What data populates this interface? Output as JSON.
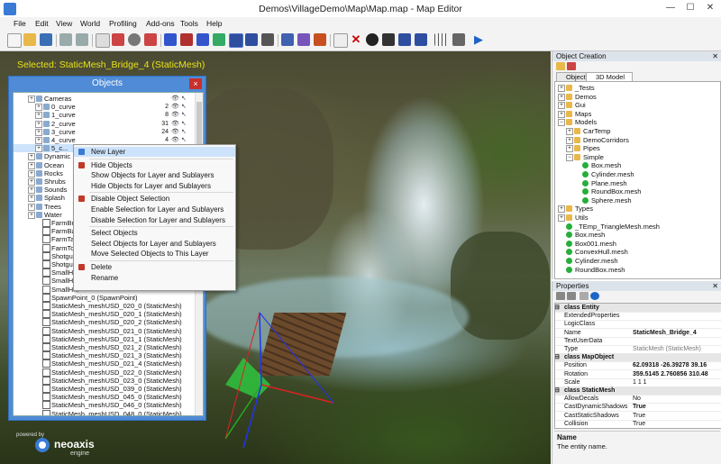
{
  "window": {
    "title": "Demos\\VillageDemo\\Map\\Map.map - Map Editor",
    "min": "—",
    "max": "☐",
    "close": "✕"
  },
  "menu": [
    "File",
    "Edit",
    "View",
    "World",
    "Profiling",
    "Add-ons",
    "Tools",
    "Help"
  ],
  "viewport": {
    "selected_label": "Selected: StaticMesh_Bridge_4 (StaticMesh)",
    "logo": {
      "powered_by": "powered by",
      "name": "neoaxis",
      "sub": "engine"
    }
  },
  "objects_window": {
    "title": "Objects",
    "close": "×",
    "rows": [
      {
        "label": "Cameras",
        "num": "",
        "type": "folder"
      },
      {
        "label": "0_curve",
        "num": "2",
        "type": "item"
      },
      {
        "label": "1_curve",
        "num": "8",
        "type": "item"
      },
      {
        "label": "2_curve",
        "num": "31",
        "type": "item"
      },
      {
        "label": "3_curve",
        "num": "24",
        "type": "item"
      },
      {
        "label": "4_curve",
        "num": "4",
        "type": "item"
      },
      {
        "label": "5_c...",
        "num": "",
        "type": "item"
      },
      {
        "label": "Dynamic",
        "num": "",
        "type": "folder"
      },
      {
        "label": "Ocean",
        "num": "",
        "type": "folder"
      },
      {
        "label": "Rocks",
        "num": "",
        "type": "folder"
      },
      {
        "label": "Shrubs",
        "num": "",
        "type": "folder"
      },
      {
        "label": "Sounds",
        "num": "",
        "type": "folder"
      },
      {
        "label": "Splash",
        "num": "",
        "type": "folder"
      },
      {
        "label": "Trees",
        "num": "",
        "type": "folder"
      },
      {
        "label": "Water",
        "num": "",
        "type": "folder"
      },
      {
        "label": "FarmBu...",
        "num": "",
        "type": "check"
      },
      {
        "label": "FarmBa...",
        "num": "",
        "type": "check"
      },
      {
        "label": "FarmTa...",
        "num": "",
        "type": "check"
      },
      {
        "label": "FarmTo...",
        "num": "",
        "type": "check"
      },
      {
        "label": "Shotgu...",
        "num": "",
        "type": "check"
      },
      {
        "label": "Shotgu...",
        "num": "",
        "type": "check"
      },
      {
        "label": "SmallH...",
        "num": "",
        "type": "check"
      },
      {
        "label": "SmallH...",
        "num": "",
        "type": "check"
      },
      {
        "label": "SmallH...",
        "num": "",
        "type": "check"
      },
      {
        "label": "SpawnPoint_0 (SpawnPoint)",
        "num": "",
        "type": "check"
      },
      {
        "label": "StaticMesh_meshUSD_020_0 (StaticMesh)",
        "num": "",
        "type": "check"
      },
      {
        "label": "StaticMesh_meshUSD_020_1 (StaticMesh)",
        "num": "",
        "type": "check"
      },
      {
        "label": "StaticMesh_meshUSD_020_2 (StaticMesh)",
        "num": "",
        "type": "check"
      },
      {
        "label": "StaticMesh_meshUSD_021_0 (StaticMesh)",
        "num": "",
        "type": "check"
      },
      {
        "label": "StaticMesh_meshUSD_021_1 (StaticMesh)",
        "num": "",
        "type": "check"
      },
      {
        "label": "StaticMesh_meshUSD_021_2 (StaticMesh)",
        "num": "",
        "type": "check"
      },
      {
        "label": "StaticMesh_meshUSD_021_3 (StaticMesh)",
        "num": "",
        "type": "check"
      },
      {
        "label": "StaticMesh_meshUSD_021_4 (StaticMesh)",
        "num": "",
        "type": "check"
      },
      {
        "label": "StaticMesh_meshUSD_022_0 (StaticMesh)",
        "num": "",
        "type": "check"
      },
      {
        "label": "StaticMesh_meshUSD_023_0 (StaticMesh)",
        "num": "",
        "type": "check"
      },
      {
        "label": "StaticMesh_meshUSD_039_0 (StaticMesh)",
        "num": "",
        "type": "check"
      },
      {
        "label": "StaticMesh_meshUSD_045_0 (StaticMesh)",
        "num": "",
        "type": "check"
      },
      {
        "label": "StaticMesh_meshUSD_046_0 (StaticMesh)",
        "num": "",
        "type": "check"
      },
      {
        "label": "StaticMesh_meshUSD_048_0 (StaticMesh)",
        "num": "",
        "type": "check"
      }
    ]
  },
  "context_menu": {
    "items": [
      {
        "label": "New Layer",
        "icon": "new-layer-icon",
        "color": "#3a7bd5"
      },
      {
        "sep": true
      },
      {
        "label": "Hide Objects",
        "icon": "hide-icon",
        "color": "#c0392b"
      },
      {
        "label": "Show Objects for Layer and Sublayers",
        "icon": "",
        "color": ""
      },
      {
        "label": "Hide Objects for Layer and Sublayers",
        "icon": "",
        "color": ""
      },
      {
        "sep": true
      },
      {
        "label": "Disable Object Selection",
        "icon": "disable-icon",
        "color": "#c0392b"
      },
      {
        "label": "Enable Selection for Layer and Sublayers",
        "icon": "",
        "color": ""
      },
      {
        "label": "Disable Selection for Layer and Sublayers",
        "icon": "",
        "color": ""
      },
      {
        "sep": true
      },
      {
        "label": "Select Objects",
        "icon": "",
        "color": ""
      },
      {
        "label": "Select Objects for Layer and Sublayers",
        "icon": "",
        "color": ""
      },
      {
        "label": "Move Selected Objects to This Layer",
        "icon": "",
        "color": ""
      },
      {
        "sep": true
      },
      {
        "label": "Delete",
        "icon": "delete-icon",
        "color": "#c0392b"
      },
      {
        "label": "Rename",
        "icon": "",
        "color": ""
      }
    ]
  },
  "object_creation": {
    "title": "Object Creation",
    "tabs": [
      "Object",
      "3D Model"
    ],
    "tree": [
      {
        "label": "_Tests",
        "depth": 0,
        "kind": "folder"
      },
      {
        "label": "Demos",
        "depth": 0,
        "kind": "folder"
      },
      {
        "label": "Gui",
        "depth": 0,
        "kind": "folder"
      },
      {
        "label": "Maps",
        "depth": 0,
        "kind": "folder"
      },
      {
        "label": "Models",
        "depth": 0,
        "kind": "folder-open"
      },
      {
        "label": "CarTemp",
        "depth": 1,
        "kind": "folder"
      },
      {
        "label": "DemoCorridors",
        "depth": 1,
        "kind": "folder"
      },
      {
        "label": "Pipes",
        "depth": 1,
        "kind": "folder"
      },
      {
        "label": "Simple",
        "depth": 1,
        "kind": "folder-open"
      },
      {
        "label": "Box.mesh",
        "depth": 2,
        "kind": "mesh"
      },
      {
        "label": "Cylinder.mesh",
        "depth": 2,
        "kind": "mesh"
      },
      {
        "label": "Plane.mesh",
        "depth": 2,
        "kind": "mesh"
      },
      {
        "label": "RoundBox.mesh",
        "depth": 2,
        "kind": "mesh"
      },
      {
        "label": "Sphere.mesh",
        "depth": 2,
        "kind": "mesh"
      },
      {
        "label": "Types",
        "depth": 0,
        "kind": "folder"
      },
      {
        "label": "Utils",
        "depth": 0,
        "kind": "folder"
      },
      {
        "label": "_TEmp_TriangleMesh.mesh",
        "depth": 0,
        "kind": "mesh"
      },
      {
        "label": "Box.mesh",
        "depth": 0,
        "kind": "mesh"
      },
      {
        "label": "Box001.mesh",
        "depth": 0,
        "kind": "mesh"
      },
      {
        "label": "ConvexHull.mesh",
        "depth": 0,
        "kind": "mesh"
      },
      {
        "label": "Cylinder.mesh",
        "depth": 0,
        "kind": "mesh"
      },
      {
        "label": "RoundBox.mesh",
        "depth": 0,
        "kind": "mesh"
      }
    ]
  },
  "properties": {
    "title": "Properties",
    "rows": [
      {
        "cat": true,
        "name": "class Entity"
      },
      {
        "name": "ExtendedProperties",
        "value": ""
      },
      {
        "name": "LogicClass",
        "value": ""
      },
      {
        "name": "Name",
        "value": "StaticMesh_Bridge_4",
        "bold": true
      },
      {
        "name": "TextUserData",
        "value": ""
      },
      {
        "name": "Type",
        "value": "StaticMesh (StaticMesh)",
        "grey": true
      },
      {
        "cat": true,
        "name": "class MapObject"
      },
      {
        "name": "Position",
        "value": "62.09318 -26.39278 39.16",
        "bold": true
      },
      {
        "name": "Rotation",
        "value": "359.5145 2.760856 310.48",
        "bold": true
      },
      {
        "name": "Scale",
        "value": "1 1 1"
      },
      {
        "cat": true,
        "name": "class StaticMesh"
      },
      {
        "name": "AllowDecals",
        "value": "No"
      },
      {
        "name": "CastDynamicShadows",
        "value": "True",
        "bold": true
      },
      {
        "name": "CastStaticShadows",
        "value": "True"
      },
      {
        "name": "Collision",
        "value": "True"
      }
    ],
    "desc_name": "Name",
    "desc_text": "The entity name."
  },
  "colors": {
    "accent": "#4f8bd6",
    "selected_label": "#e8e21a",
    "mesh_icon": "#27ae3a",
    "folder_icon": "#e8b84a"
  }
}
